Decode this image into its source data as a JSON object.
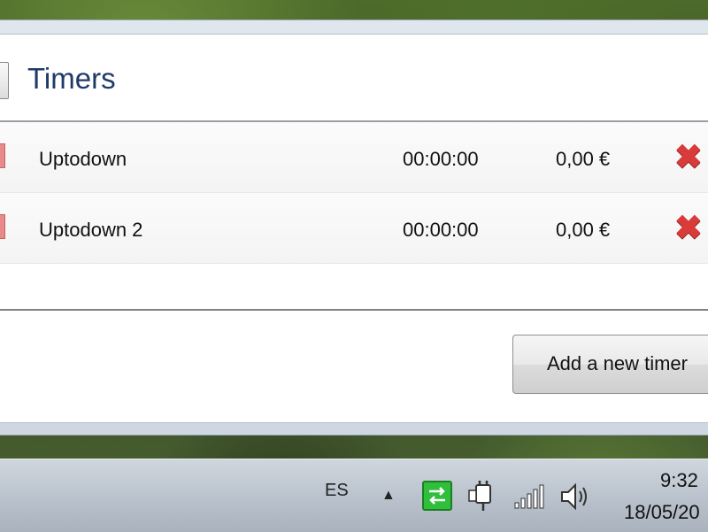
{
  "window": {
    "title": "Timers"
  },
  "timers": [
    {
      "name": "Uptodown",
      "time": "00:00:00",
      "cost": "0,00 €",
      "color": "#e88a8a"
    },
    {
      "name": "Uptodown 2",
      "time": "00:00:00",
      "cost": "0,00 €",
      "color": "#e88a8a"
    }
  ],
  "actions": {
    "add_label": "Add a new timer",
    "delete_icon": "✖"
  },
  "taskbar": {
    "language": "ES",
    "tray_expand": "▲",
    "clock_time": "9:32",
    "clock_date": "18/05/20"
  },
  "icons": {
    "delete": "close-icon",
    "network": "network-icon",
    "power": "power-plug-icon",
    "signal": "signal-icon",
    "volume": "speaker-icon"
  }
}
